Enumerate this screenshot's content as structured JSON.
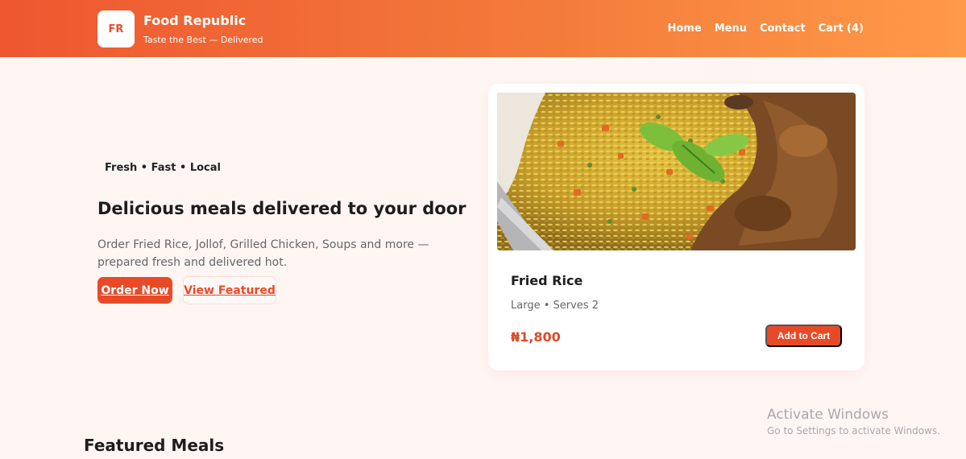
{
  "brand": {
    "logo_text": "FR",
    "name": "Food Republic",
    "tagline": "Taste the Best — Delivered"
  },
  "nav": {
    "items": [
      "Home",
      "Menu",
      "Contact",
      "Cart (4)"
    ]
  },
  "hero": {
    "tagline": "Fresh • Fast • Local",
    "title": "Delicious meals delivered to your door",
    "description": "Order Fried Rice, Jollof, Grilled Chicken, Soups and more — prepared fresh and delivered hot.",
    "primary_button": "Order Now",
    "secondary_button": "View Featured"
  },
  "featured_card": {
    "image_icon": "fried-rice-image",
    "name": "Fried Rice",
    "details": "Large • Serves 2",
    "price": "₦1,800",
    "button": "Add to Cart"
  },
  "sections": {
    "featured_title": "Featured Meals"
  },
  "watermark": {
    "title": "Activate Windows",
    "subtitle": "Go to Settings to activate Windows."
  },
  "colors": {
    "accent": "#e84a27",
    "header_gradient_start": "#ee5730",
    "header_gradient_end": "#ff9a48",
    "page_background": "#fff6f4"
  }
}
